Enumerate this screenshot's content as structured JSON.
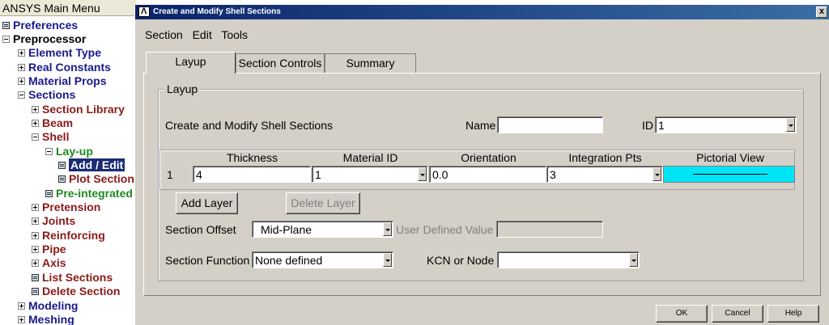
{
  "main_menu": {
    "title": "ANSYS Main Menu",
    "items": [
      {
        "label": "Preferences",
        "icon": "doc-icon"
      },
      {
        "label": "Preprocessor",
        "icon": "minus-icon"
      },
      {
        "label": "Element Type",
        "icon": "plus-icon"
      },
      {
        "label": "Real Constants",
        "icon": "plus-icon"
      },
      {
        "label": "Material Props",
        "icon": "plus-icon"
      },
      {
        "label": "Sections",
        "icon": "minus-icon"
      },
      {
        "label": "Section Library",
        "icon": "plus-icon"
      },
      {
        "label": "Beam",
        "icon": "plus-icon"
      },
      {
        "label": "Shell",
        "icon": "minus-icon"
      },
      {
        "label": "Lay-up",
        "icon": "minus-icon"
      },
      {
        "label": "Add / Edit",
        "icon": "doc-icon"
      },
      {
        "label": "Plot Section",
        "icon": "doc-icon"
      },
      {
        "label": "Pre-integrated",
        "icon": "doc-icon"
      },
      {
        "label": "Pretension",
        "icon": "plus-icon"
      },
      {
        "label": "Joints",
        "icon": "plus-icon"
      },
      {
        "label": "Reinforcing",
        "icon": "plus-icon"
      },
      {
        "label": "Pipe",
        "icon": "plus-icon"
      },
      {
        "label": "Axis",
        "icon": "plus-icon"
      },
      {
        "label": "List Sections",
        "icon": "doc-icon"
      },
      {
        "label": "Delete Section",
        "icon": "doc-icon"
      },
      {
        "label": "Modeling",
        "icon": "plus-icon"
      },
      {
        "label": "Meshing",
        "icon": "plus-icon"
      }
    ]
  },
  "dialog": {
    "title": "Create and Modify Shell Sections",
    "close_label": "x",
    "menu": [
      "Section",
      "Edit",
      "Tools"
    ],
    "tabs": [
      "Layup",
      "Section Controls",
      "Summary"
    ],
    "group_label": "Layup",
    "heading": "Create and Modify Shell Sections",
    "name_label": "Name",
    "name_value": "",
    "id_label": "ID",
    "id_value": "1",
    "table": {
      "columns": [
        "Thickness",
        "Material ID",
        "Orientation",
        "Integration Pts",
        "Pictorial View"
      ],
      "row_number": "1",
      "thickness": "4",
      "material_id": "1",
      "orientation": "0.0",
      "integration_pts": "3"
    },
    "add_layer": "Add Layer",
    "delete_layer": "Delete Layer",
    "section_offset_label": "Section Offset",
    "section_offset_value": "Mid-Plane",
    "user_defined_label": "User Defined Value",
    "user_defined_value": "",
    "section_function_label": "Section Function",
    "section_function_value": "None defined",
    "kcn_label": "KCN or Node",
    "kcn_value": "",
    "buttons": {
      "ok": "OK",
      "cancel": "Cancel",
      "help": "Help"
    },
    "colors": {
      "pictorial_fill": "#00e5f5",
      "titlebar": "#0a246a",
      "selection": "#1a2c73"
    }
  }
}
